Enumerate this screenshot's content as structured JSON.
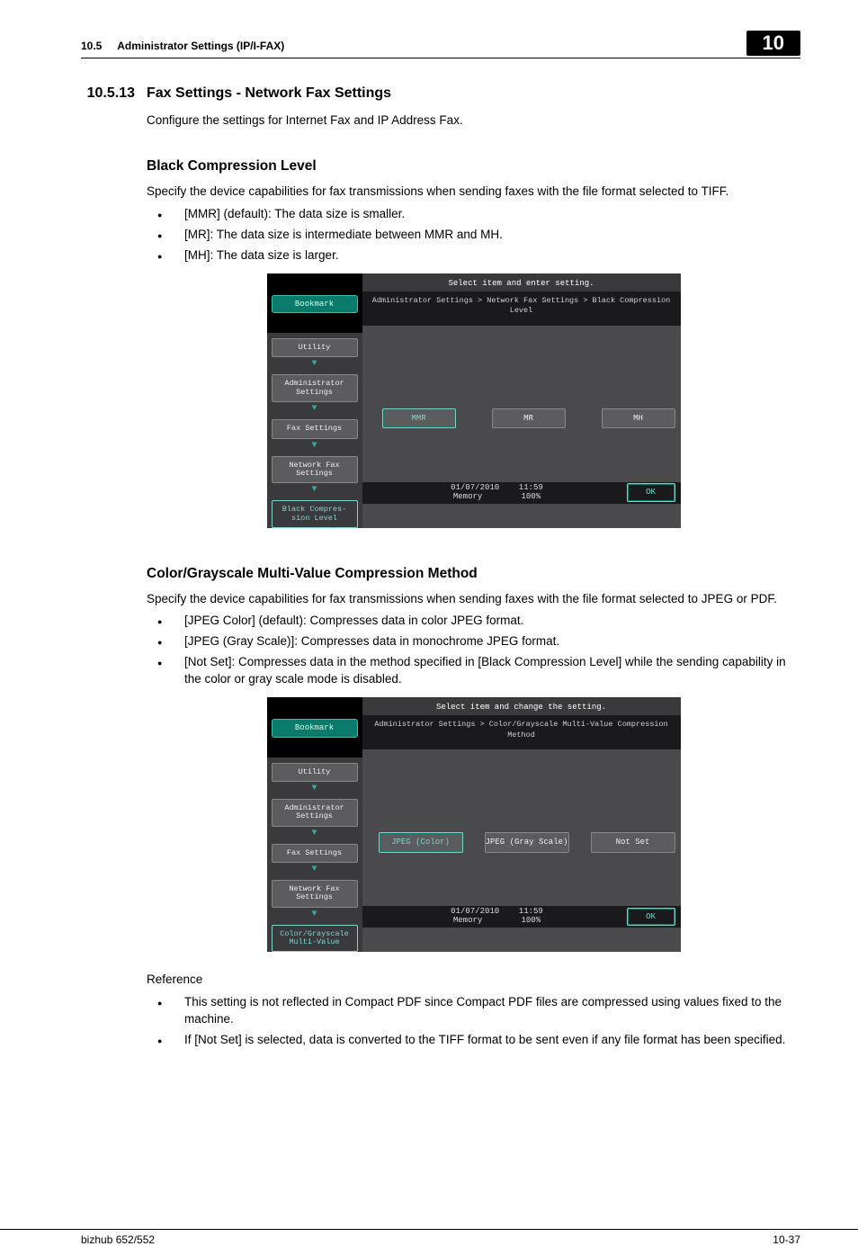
{
  "header": {
    "section_num": "10.5",
    "section_title": "Administrator Settings (IP/I-FAX)",
    "chapter": "10"
  },
  "h3": {
    "num": "10.5.13",
    "title": "Fax Settings - Network Fax Settings"
  },
  "intro": "Configure the settings for Internet Fax and IP Address Fax.",
  "black": {
    "heading": "Black Compression Level",
    "para": "Specify the device capabilities for fax transmissions when sending faxes with the file format selected to TIFF.",
    "b1": "[MMR] (default): The data size is smaller.",
    "b2": "[MR]: The data size is intermediate between MMR and MH.",
    "b3": "[MH]: The data size is larger."
  },
  "shot1": {
    "msg": "Select item and enter setting.",
    "bookmark": "Bookmark",
    "crumb": "Administrator Settings > Network Fax Settings > Black Compression Level",
    "nav1": "Utility",
    "nav2": "Administrator Settings",
    "nav3": "Fax Settings",
    "nav4": "Network Fax Settings",
    "nav5": "Black Compres- sion Level",
    "opt1": "MMR",
    "opt2": "MR",
    "opt3": "MH",
    "date": "01/07/2010",
    "time": "11:59",
    "mem": "Memory",
    "memv": "100%",
    "ok": "OK"
  },
  "color": {
    "heading": "Color/Grayscale Multi-Value Compression Method",
    "para": "Specify the device capabilities for fax transmissions when sending faxes with the file format selected to JPEG or PDF.",
    "b1": "[JPEG Color] (default): Compresses data in color JPEG format.",
    "b2": "[JPEG (Gray Scale)]: Compresses data in monochrome JPEG format.",
    "b3": "[Not Set]: Compresses data in the method specified in [Black Compression Level] while the sending capability in the color or gray scale mode is disabled."
  },
  "shot2": {
    "msg": "Select item and change the setting.",
    "bookmark": "Bookmark",
    "crumb": "Administrator Settings > Color/Grayscale Multi-Value Compression Method",
    "nav1": "Utility",
    "nav2": "Administrator Settings",
    "nav3": "Fax Settings",
    "nav4": "Network Fax Settings",
    "nav5": "Color/Grayscale Multi-Value",
    "opt1": "JPEG (Color)",
    "opt2": "JPEG (Gray Scale)",
    "opt3": "Not Set",
    "date": "01/07/2010",
    "time": "11:59",
    "mem": "Memory",
    "memv": "100%",
    "ok": "OK"
  },
  "ref": {
    "heading": "Reference",
    "b1": "This setting is not reflected in Compact PDF since Compact PDF files are compressed using values fixed to the machine.",
    "b2": "If [Not Set] is selected, data is converted to the TIFF format to be sent even if any file format has been specified."
  },
  "footer": {
    "left": "bizhub 652/552",
    "right": "10-37"
  }
}
